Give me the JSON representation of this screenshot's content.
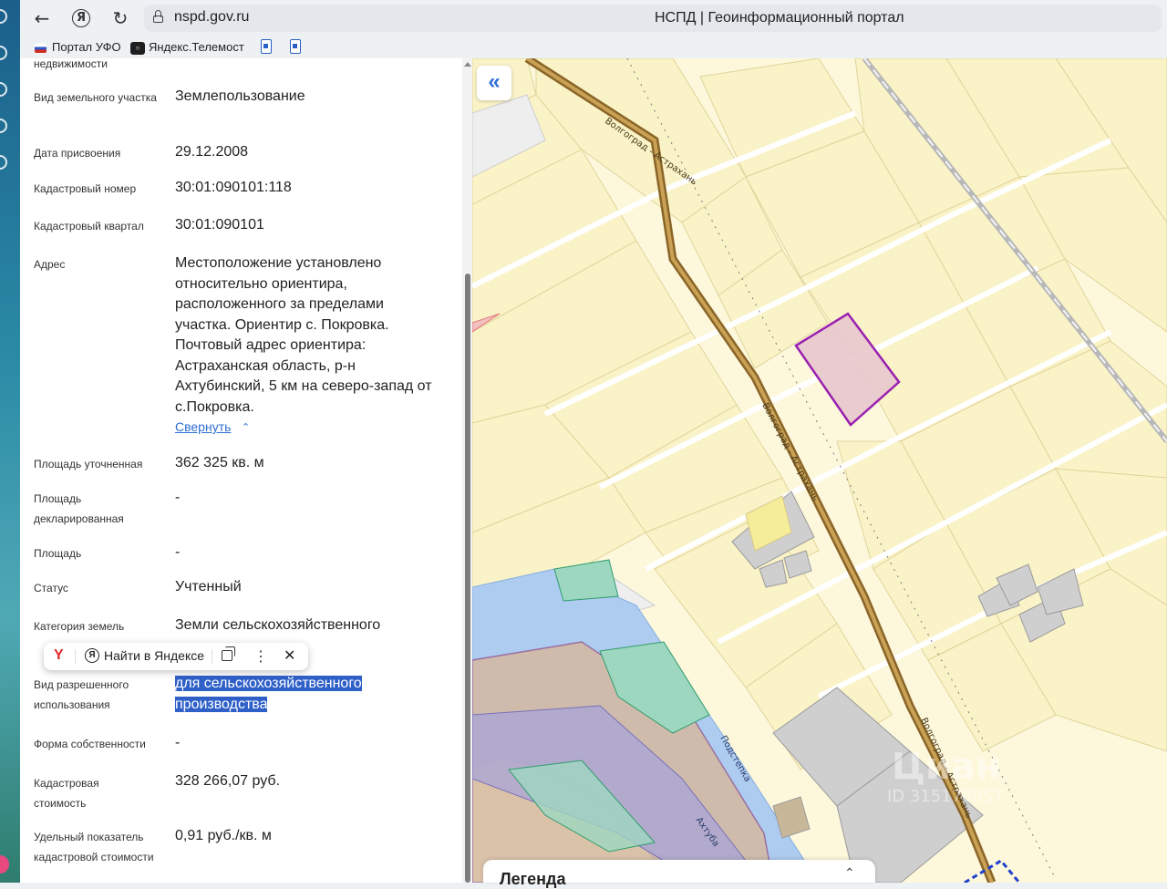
{
  "browser": {
    "url": "nspd.gov.ru",
    "page_title": "НСПД | Геоинформационный портал",
    "bookmarks": [
      {
        "label": "Портал УФО"
      },
      {
        "label": "Яндекс.Телемост"
      }
    ]
  },
  "panel": {
    "top_fragment": "недвижимости",
    "rows": [
      {
        "label": "Вид земельного участка",
        "value": "Землепользование"
      },
      {
        "label": "Дата присвоения",
        "value": "29.12.2008"
      },
      {
        "label": "Кадастровый номер",
        "value": "30:01:090101:118"
      },
      {
        "label": "Кадастровый квартал",
        "value": "30:01:090101"
      },
      {
        "label": "Адрес",
        "value": "Местоположение установлено относительно ориентира, расположенного за пределами участка. Ориентир с. Покровка. Почтовый адрес ориентира: Астраханская область, р-н Ахтубинский, 5 км на северо-запад от с.Покровка."
      },
      {
        "label": "Площадь уточненная",
        "value": "362 325 кв. м"
      },
      {
        "label": "Площадь декларированная",
        "value": "-"
      },
      {
        "label": "Площадь",
        "value": "-"
      },
      {
        "label": "Статус",
        "value": "Учтенный"
      },
      {
        "label": "Категория земель",
        "value": "Земли сельскохозяйственного"
      },
      {
        "label": "Вид разрешенного использования",
        "value_line1": "для сельскохозяйственного",
        "value_line2": "производства"
      },
      {
        "label": "Форма собственности",
        "value": "-"
      },
      {
        "label": "Кадастровая стоимость",
        "value": "328 266,07 руб."
      },
      {
        "label": "Удельный показатель кадастровой стоимости",
        "value": "0,91 руб./кв. м"
      }
    ],
    "collapse_link": "Свернуть"
  },
  "context_popup": {
    "search_label": "Найти в Яндексе",
    "y_glyph": "Y",
    "ya_glyph": "Я",
    "dots": "⋮",
    "close": "✕"
  },
  "map": {
    "collapse_glyph": "«",
    "legend_title": "Легенда",
    "road_labels": [
      "Волгоград - Астрахань",
      "Волгоград - Астрахань",
      "Волгоград - Астрахань"
    ],
    "river_labels": [
      "Ахтуба",
      "Подстепка"
    ],
    "watermark": "Циан",
    "watermark_id": "ID 315178957",
    "colors": {
      "parcel_fill": "#faf3c8",
      "parcel_stroke": "#d8c98a",
      "selected_parcel_fill": "#e8c6ce",
      "selected_parcel_stroke": "#9a1fb0",
      "road": "#a37c3a",
      "water": "#aecbf0",
      "wetland": "#9ed7c0",
      "forest_zone": "#c9b79a"
    }
  }
}
